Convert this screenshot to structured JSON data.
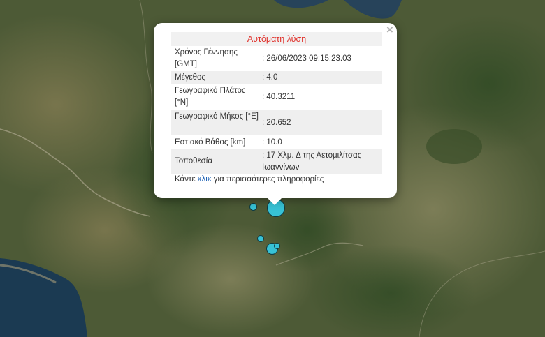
{
  "map": {
    "colors": {
      "land": "#4d5a36",
      "sea": "#1b3a52",
      "lake": "#27435a"
    }
  },
  "markers": [
    {
      "name": "large",
      "color": "#37c2d6"
    },
    {
      "name": "small",
      "color": "#37c2d6"
    },
    {
      "name": "small",
      "color": "#37c2d6"
    },
    {
      "name": "medium",
      "color": "#37c2d6"
    },
    {
      "name": "small",
      "color": "#37c2d6"
    }
  ],
  "popup": {
    "title": "Αυτόματη λύση",
    "title_color": "#e0302a",
    "close_symbol": "×",
    "rows": [
      {
        "label": "Χρόνος Γέννησης [GMT]",
        "value": ": 26/06/2023 09:15:23.03"
      },
      {
        "label": "Μέγεθος",
        "value": ": 4.0"
      },
      {
        "label": "Γεωγραφικό Πλάτος [°N]",
        "value": ": 40.3211"
      },
      {
        "label": "Γεωγραφικό Μήκος [°E]",
        "value": ": 20.652"
      },
      {
        "label": "Εστιακό Βάθος [km]",
        "value": ": 10.0"
      },
      {
        "label": "Τοποθεσία",
        "value": ": 17 Χλμ. Δ της Αετομιλίτσας Ιωαννίνων"
      }
    ],
    "more": {
      "prefix": "Κάντε ",
      "link": "κλικ",
      "suffix": " για περισσότερες πληροφορίες",
      "link_color": "#1a5fb4"
    }
  }
}
